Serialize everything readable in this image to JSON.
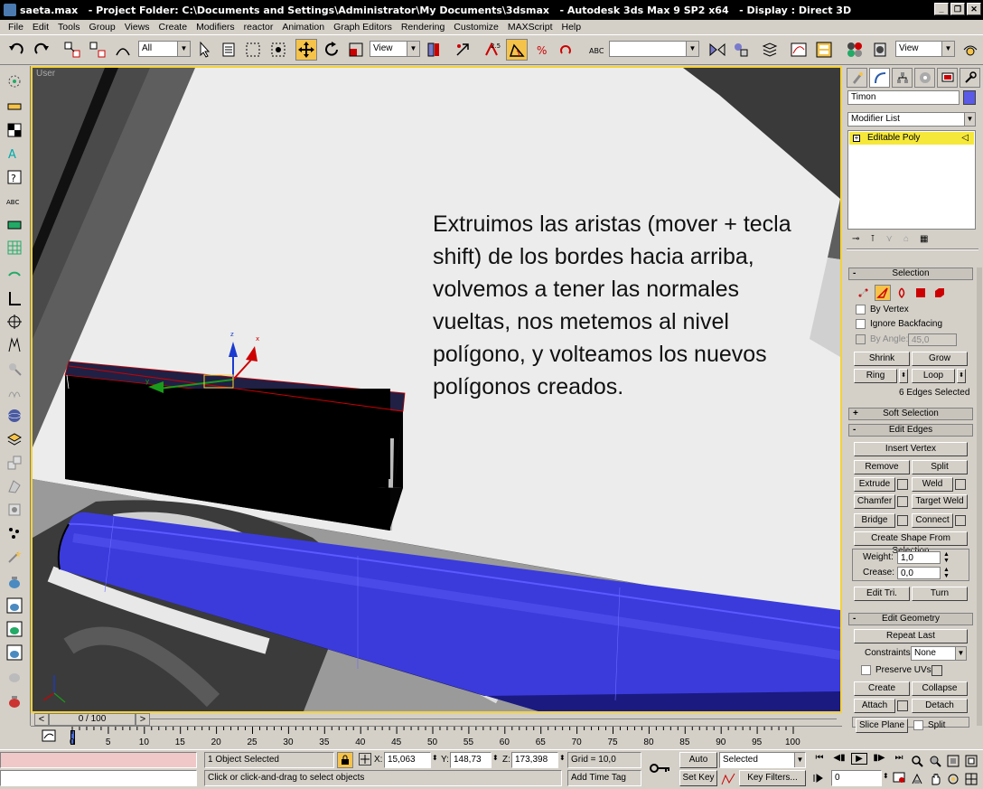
{
  "window": {
    "title": "saeta.max   - Project Folder: C:\\Documents and Settings\\Administrator\\My Documents\\3dsmax   - Autodesk 3ds Max 9 SP2 x64   - Display : Direct 3D"
  },
  "menu": [
    "File",
    "Edit",
    "Tools",
    "Group",
    "Views",
    "Create",
    "Modifiers",
    "reactor",
    "Animation",
    "Graph Editors",
    "Rendering",
    "Customize",
    "MAXScript",
    "Help"
  ],
  "toolbar": {
    "selection_filter": "All",
    "reference_coord": "View",
    "named_selection": "",
    "snap_angle": "2.5",
    "view_combo": "View"
  },
  "viewport": {
    "label": "User",
    "annotation": "Extruimos las aristas (mover + tecla shift) de los bordes hacia arriba, volvemos a tener las normales vueltas, nos metemos al nivel polígono, y volteamos los nuevos polígonos creados.",
    "gizmo_x": "x",
    "gizmo_y": "y",
    "gizmo_z": "z"
  },
  "command_panel": {
    "object_name": "Timon",
    "object_color": "#5a5ae6",
    "modifier_list_label": "Modifier List",
    "stack_item": "Editable Poly",
    "selection": {
      "title": "Selection",
      "by_vertex": "By Vertex",
      "ignore_backfacing": "Ignore Backfacing",
      "by_angle": "By Angle:",
      "by_angle_value": "45,0",
      "shrink": "Shrink",
      "grow": "Grow",
      "ring": "Ring",
      "loop": "Loop",
      "status": "6 Edges Selected"
    },
    "soft_selection": {
      "title": "Soft Selection"
    },
    "edit_edges": {
      "title": "Edit Edges",
      "insert_vertex": "Insert Vertex",
      "remove": "Remove",
      "split": "Split",
      "extrude": "Extrude",
      "weld": "Weld",
      "chamfer": "Chamfer",
      "target_weld": "Target Weld",
      "bridge": "Bridge",
      "connect": "Connect",
      "create_shape": "Create Shape From Selection",
      "weight_label": "Weight:",
      "weight_value": "1,0",
      "crease_label": "Crease:",
      "crease_value": "0,0",
      "edit_tri": "Edit Tri.",
      "turn": "Turn"
    },
    "edit_geometry": {
      "title": "Edit Geometry",
      "repeat_last": "Repeat Last",
      "constraints_label": "Constraints:",
      "constraints_value": "None",
      "preserve_uvs": "Preserve UVs",
      "create": "Create",
      "collapse": "Collapse",
      "attach": "Attach",
      "detach": "Detach",
      "slice_plane": "Slice Plane",
      "split": "Split"
    }
  },
  "timeline": {
    "frame_counter": "0 / 100",
    "ticks": [
      "0",
      "5",
      "10",
      "15",
      "20",
      "25",
      "30",
      "35",
      "40",
      "45",
      "50",
      "55",
      "60",
      "65",
      "70",
      "75",
      "80",
      "85",
      "90",
      "95",
      "100"
    ]
  },
  "status": {
    "selection_info": "1 Object Selected",
    "prompt": "Click or click-and-drag to select objects",
    "x_label": "X:",
    "x_value": "15,063",
    "y_label": "Y:",
    "y_value": "148,73",
    "z_label": "Z:",
    "z_value": "173,398",
    "grid": "Grid = 10,0",
    "add_time_tag": "Add Time Tag",
    "auto_key": "Auto Key",
    "set_key": "Set Key",
    "selected_combo": "Selected",
    "key_filters": "Key Filters...",
    "frame_value": "0"
  }
}
